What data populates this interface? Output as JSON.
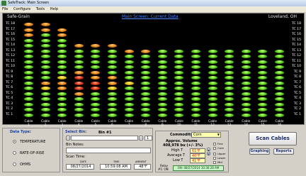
{
  "window": {
    "title": "SafeTrack: Main Screen"
  },
  "menu": [
    "File",
    "Configure",
    "Tools",
    "Help"
  ],
  "header": {
    "company": "Safe-Grain",
    "title": "Main Screen: Current Data",
    "location": "Loveland, OH"
  },
  "tc_labels": [
    "TC 18",
    "TC 17",
    "TC 16",
    "TC 15",
    "TC 14",
    "TC 13",
    "TC 12",
    "TC 11",
    "TC 10",
    "TC 9",
    "TC 8",
    "TC 7",
    "TC 6",
    "TC 5",
    "TC 4",
    "TC 3",
    "TC 2",
    "TC 1"
  ],
  "cables": [
    "1",
    "2",
    "3",
    "4",
    "5",
    "6",
    "7",
    "8",
    "9",
    "10",
    "11",
    "12",
    "13",
    "14",
    "15",
    "16"
  ],
  "cable_word": "Cable",
  "data_type": {
    "title": "Data Type:",
    "options": [
      "TEMPERATURE",
      "RATE-OF-RISE",
      "OHMS"
    ],
    "selected": "TEMPERATURE"
  },
  "select_bin": {
    "title": "Select Bin:",
    "bin_name": "Bin #1",
    "bin_number": "1",
    "notes_label": "Bin Notes:",
    "notes": "",
    "scan_time_label": "Scan Time:",
    "date_label": "DATE",
    "date": "08/27/2014",
    "time_label": "TIME",
    "time": "10:59:08 AM",
    "ambient_label": "AMBIENT",
    "ambient": "48°F"
  },
  "commodity": {
    "label": "Commodity:",
    "value": "Corn",
    "volume_label": "Approx. Volume",
    "volume": "408,978 bu (+/- 3%)",
    "high_label": "High T",
    "high": "61°F",
    "average_label": "Average T",
    "average": "40°F",
    "low_label": "Low T",
    "low": "41°F",
    "checks": [
      "Fine",
      "Core",
      "Upper",
      "Lower",
      "Mid"
    ],
    "relay_label": "Relay",
    "relay_sub": "#1: ON",
    "relay_status": "ON: 08/27/2014 10:36:28 AM"
  },
  "buttons": {
    "scan": "Scan Cables",
    "graphing": "Graphing",
    "reports": "Reports"
  },
  "colors": {
    "green": "#5cd21b",
    "yellow": "#e5c412",
    "orange": "#e88a18",
    "red": "#e03a18",
    "title_blue": "#4a84ff"
  },
  "sensor_heights": [
    18,
    18,
    17,
    14,
    14,
    14,
    13,
    13,
    13,
    13,
    13,
    13,
    13,
    13,
    13,
    13
  ],
  "sensor_warm": [
    {
      "cable": 1,
      "tc": 18,
      "level": "orange"
    },
    {
      "cable": 1,
      "tc": 17,
      "level": "orange"
    },
    {
      "cable": 1,
      "tc": 16,
      "level": "orange"
    },
    {
      "cable": 2,
      "tc": 18,
      "level": "orange"
    },
    {
      "cable": 2,
      "tc": 17,
      "level": "orange"
    },
    {
      "cable": 3,
      "tc": 17,
      "level": "orange"
    },
    {
      "cable": 3,
      "tc": 16,
      "level": "orange"
    },
    {
      "cable": 4,
      "tc": 14,
      "level": "orange"
    },
    {
      "cable": 5,
      "tc": 14,
      "level": "orange"
    },
    {
      "cable": 6,
      "tc": 14,
      "level": "orange"
    },
    {
      "cable": 7,
      "tc": 13,
      "level": "orange"
    },
    {
      "cable": 8,
      "tc": 13,
      "level": "orange"
    },
    {
      "cable": 4,
      "tc": 5,
      "level": "orange"
    },
    {
      "cable": 4,
      "tc": 6,
      "level": "red"
    },
    {
      "cable": 4,
      "tc": 7,
      "level": "red"
    },
    {
      "cable": 4,
      "tc": 8,
      "level": "red"
    },
    {
      "cable": 4,
      "tc": 9,
      "level": "orange"
    },
    {
      "cable": 3,
      "tc": 6,
      "level": "orange"
    },
    {
      "cable": 3,
      "tc": 7,
      "level": "orange"
    },
    {
      "cable": 5,
      "tc": 6,
      "level": "red"
    },
    {
      "cable": 5,
      "tc": 7,
      "level": "red"
    },
    {
      "cable": 5,
      "tc": 8,
      "level": "orange"
    },
    {
      "cable": 5,
      "tc": 9,
      "level": "orange"
    },
    {
      "cable": 6,
      "tc": 7,
      "level": "orange"
    },
    {
      "cable": 6,
      "tc": 8,
      "level": "orange"
    },
    {
      "cable": 2,
      "tc": 7,
      "level": "orange"
    },
    {
      "cable": 7,
      "tc": 7,
      "level": "yellow"
    },
    {
      "cable": 3,
      "tc": 8,
      "level": "yellow"
    },
    {
      "cable": 6,
      "tc": 6,
      "level": "yellow"
    },
    {
      "cable": 2,
      "tc": 6,
      "level": "yellow"
    }
  ]
}
